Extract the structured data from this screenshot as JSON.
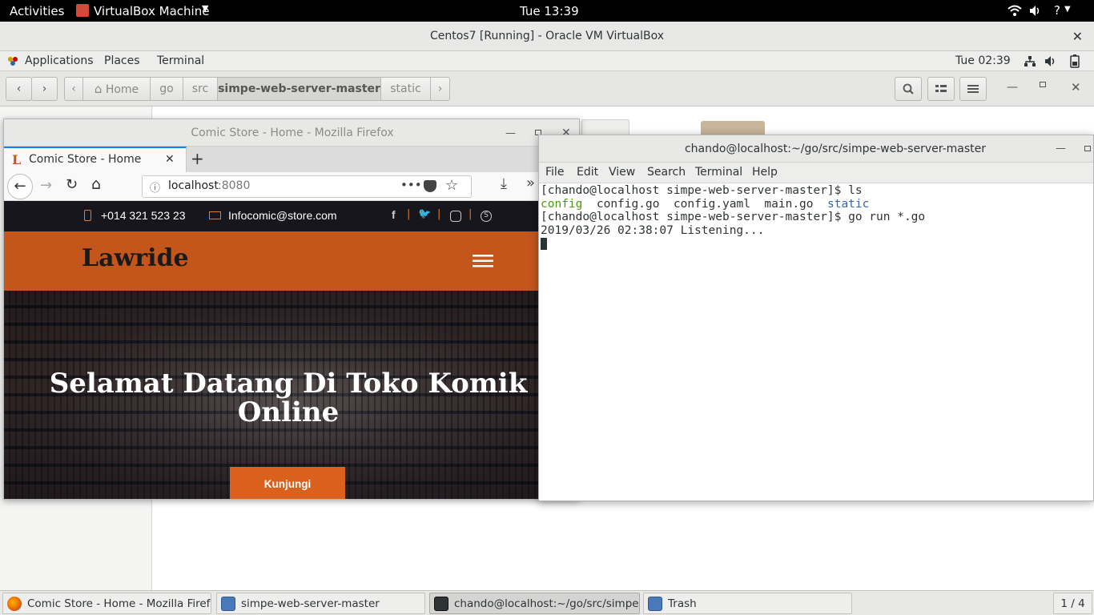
{
  "host": {
    "activities": "Activities",
    "app_menu": "VirtualBox Machine",
    "clock": "Tue 13:39"
  },
  "vbox": {
    "title": "Centos7 [Running] - Oracle VM VirtualBox"
  },
  "guest": {
    "applications": "Applications",
    "places": "Places",
    "terminal": "Terminal",
    "clock": "Tue 02:39"
  },
  "nautilus": {
    "breadcrumbs": [
      "Home",
      "go",
      "src",
      "simpe-web-server-master",
      "static"
    ]
  },
  "firefox": {
    "window_title": "Comic Store - Home - Mozilla Firefox",
    "tab_label": "Comic Store - Home",
    "url_host": "localhost",
    "url_port": ":8080",
    "site": {
      "phone": "+014 321 523 23",
      "email": "Infocomic@store.com",
      "logo": "Lawride",
      "hero_title": "Selamat Datang Di Toko Komik Online",
      "cta": "Kunjungi",
      "brand_color": "#c4561c"
    }
  },
  "terminal": {
    "window_title": "chando@localhost:~/go/src/simpe-web-server-master",
    "menu": [
      "File",
      "Edit",
      "View",
      "Search",
      "Terminal",
      "Help"
    ],
    "lines": [
      "[chando@localhost simpe-web-server-master]$ ls",
      "",
      "[chando@localhost simpe-web-server-master]$ go run *.go",
      "2019/03/26 02:38:07 Listening..."
    ],
    "ls_output": [
      "config",
      "config.go",
      "config.yaml",
      "main.go",
      "static"
    ]
  },
  "taskbar": {
    "items": [
      "Comic Store - Home - Mozilla Firefox",
      "simpe-web-server-master",
      "chando@localhost:~/go/src/simpe-...",
      "Trash"
    ],
    "workspace": "1 / 4"
  }
}
